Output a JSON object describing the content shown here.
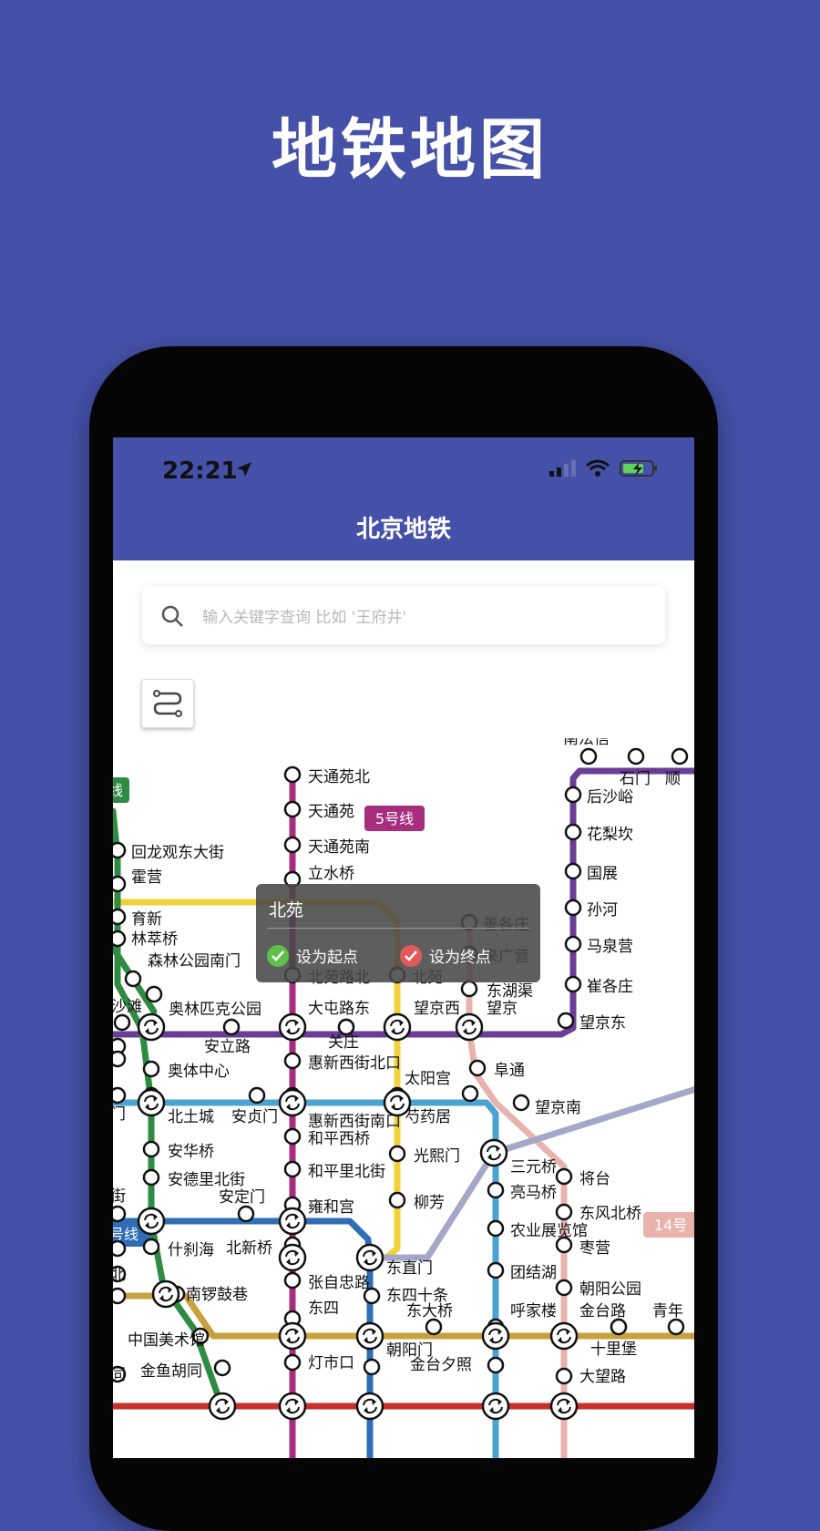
{
  "promo": {
    "title": "地铁地图"
  },
  "status_bar": {
    "time": "22:21"
  },
  "app": {
    "title": "北京地铁"
  },
  "search": {
    "placeholder": "输入关键字查询 比如 '王府井'"
  },
  "popup": {
    "station": "北苑",
    "set_start": "设为起点",
    "set_end": "设为终点"
  },
  "icons": [
    "location-arrow-icon",
    "signal-icon",
    "wifi-icon",
    "battery-charging-icon",
    "search-icon",
    "route-filter-icon",
    "check-icon",
    "transfer-icon"
  ],
  "colors": {
    "brand": "#4550a8",
    "line5": "#a62e7d",
    "line10": "#4ba3d3",
    "line6": "#c9a13c",
    "line15": "#6a3d96",
    "line13": "#f2d23c",
    "line8": "#2e8b42",
    "line2": "#2f6db5",
    "line14": "#e9b3ad",
    "airport": "#a6a6c9",
    "line1": "#c8302c"
  },
  "map": {
    "line_labels": [
      {
        "id": "line5",
        "text": "5号线"
      },
      {
        "id": "line8",
        "text": "线"
      },
      {
        "id": "line2",
        "text": "号线"
      },
      {
        "id": "line14",
        "text": "14号"
      }
    ],
    "stations": [
      "南法信",
      "石门",
      "顺",
      "后沙峪",
      "花梨坎",
      "国展",
      "孙河",
      "马泉营",
      "崔各庄",
      "望京东",
      "天通苑北",
      "天通苑",
      "天通苑南",
      "立水桥",
      "北苑路北",
      "北苑",
      "大屯路东",
      "关庄",
      "惠新西街北口",
      "惠新西街南口",
      "和平西桥",
      "和平里北街",
      "雍和宫",
      "北新桥",
      "张自忠路",
      "东四",
      "灯市口",
      "善各庄",
      "来广营",
      "东湖渠",
      "望京西",
      "望京",
      "阜通",
      "望京南",
      "太阳宫",
      "芍药居",
      "光熙门",
      "柳芳",
      "三元桥",
      "将台",
      "亮马桥",
      "东风北桥",
      "农业展览馆",
      "枣营",
      "团结湖",
      "朝阳公园",
      "呼家楼",
      "金台路",
      "青年",
      "十里堡",
      "大望路",
      "东直门",
      "东四十条",
      "东大桥",
      "朝阳门",
      "金台夕照",
      "回龙观东大街",
      "霍营",
      "育新",
      "林萃桥",
      "森林公园南门",
      "奥林匹克公园",
      "沙滩",
      "安立路",
      "口",
      "桥",
      "奥体中心",
      "德门",
      "北土城",
      "安贞门",
      "安华桥",
      "安德里北街",
      "安定门",
      "大街",
      "什刹海",
      "口",
      "海北",
      "南锣鼓巷",
      "里",
      "中国美术馆",
      "胡同",
      "金鱼胡同"
    ]
  }
}
